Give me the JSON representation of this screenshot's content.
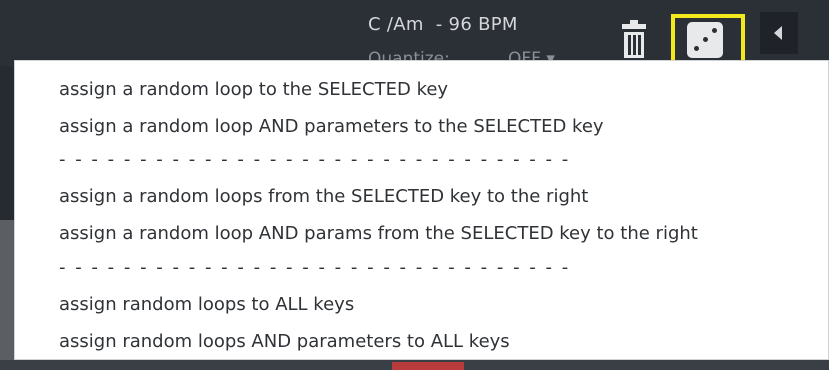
{
  "header": {
    "key_bpm": "C /Am  - 96 BPM",
    "quantize_label": "Quantize:",
    "quantize_value": "OFF ▾"
  },
  "icons": {
    "trash": "trash-icon",
    "dice": "dice-icon",
    "nav": "triangle-left-icon"
  },
  "colors": {
    "highlight": "#f3e81b",
    "background": "#2b2f36",
    "menu_bg": "#ffffff",
    "menu_text": "#2f3236"
  },
  "menu": {
    "items": [
      "assign a random loop to the SELECTED key",
      "assign a random loop AND parameters to the SELECTED key",
      "- - - - - - - - - - - - - - - - - - - - - - - - - - - - - - - -",
      "assign a random loops from the SELECTED key to the right",
      "assign a random loop AND params from the SELECTED key to the right",
      "- - - - - - - - - - - - - - - - - - - - - - - - - - - - - - - -",
      "assign random loops to ALL keys",
      "assign random loops AND parameters to ALL keys"
    ]
  }
}
